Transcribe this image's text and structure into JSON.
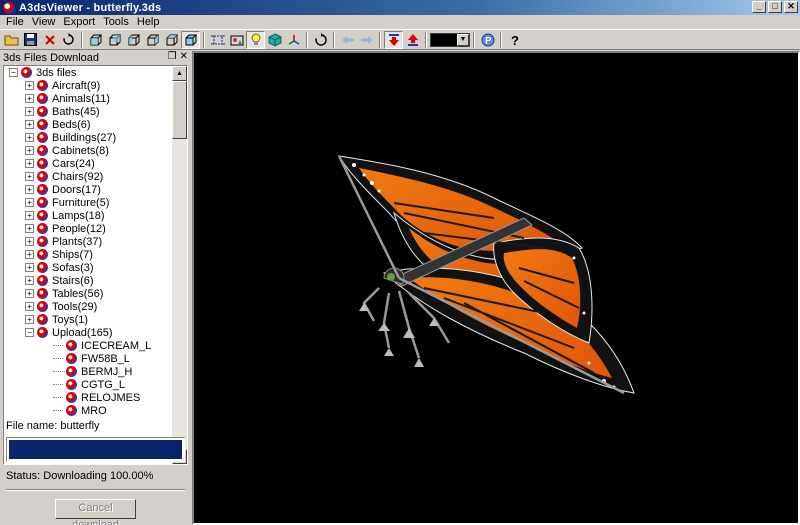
{
  "window": {
    "title": "A3dsViewer - butterfly.3ds",
    "buttons": [
      "_",
      "□",
      "✕"
    ]
  },
  "menu": [
    "File",
    "View",
    "Export",
    "Tools",
    "Help"
  ],
  "toolbar": {
    "selected_color": "#000000"
  },
  "panel": {
    "title": "3ds Files Download",
    "tree": {
      "root": "3ds files",
      "categories": [
        "Aircraft(9)",
        "Animals(11)",
        "Baths(45)",
        "Beds(6)",
        "Buildings(27)",
        "Cabinets(8)",
        "Cars(24)",
        "Chairs(92)",
        "Doors(17)",
        "Furniture(5)",
        "Lamps(18)",
        "People(12)",
        "Plants(37)",
        "Ships(7)",
        "Sofas(3)",
        "Stairs(6)",
        "Tables(56)",
        "Tools(29)",
        "Toys(1)",
        "Upload(165)"
      ],
      "upload_children": [
        "ICECREAM_L",
        "FW58B_L",
        "BERMJ_H",
        "CGTG_L",
        "RELOJMES",
        "MRO"
      ]
    },
    "file_name": "File name: butterfly",
    "status": "Status: Downloading  100.00%",
    "progress_fraction": 1.0,
    "cancel_label": "Cancel download"
  },
  "viewport": {
    "background": "#000000",
    "model": "butterfly"
  }
}
